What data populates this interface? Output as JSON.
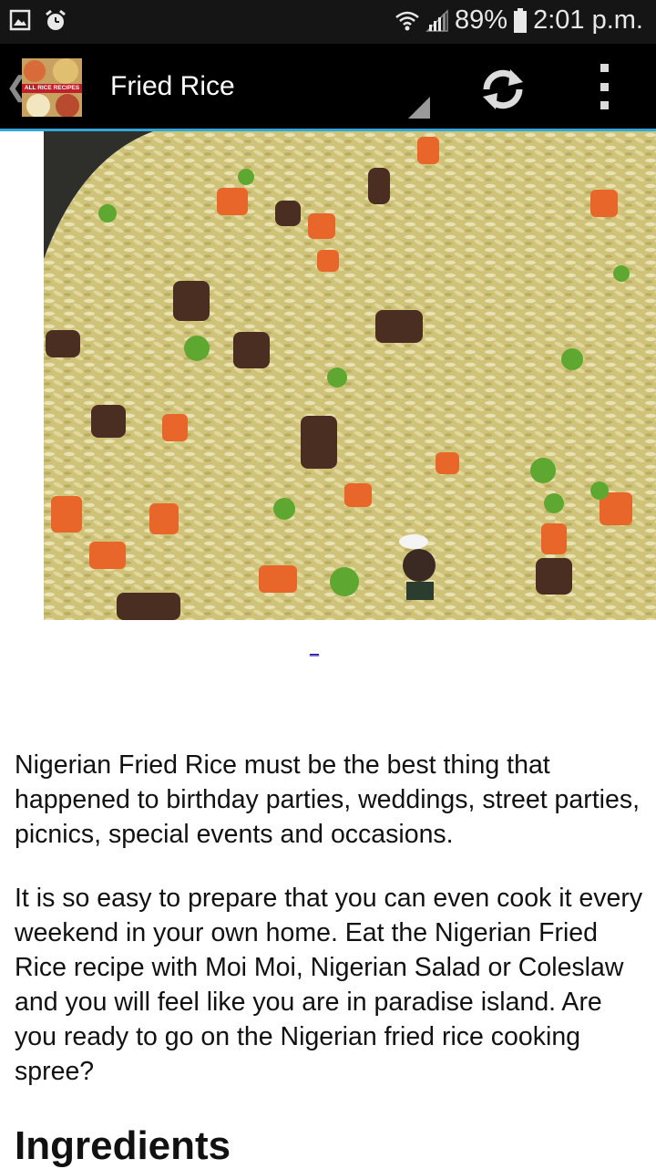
{
  "status_bar": {
    "battery": "89%",
    "time": "2:01 p.m.",
    "icons": [
      "image-icon",
      "alarm-icon",
      "wifi-icon",
      "signal-icon",
      "battery-icon"
    ]
  },
  "action_bar": {
    "title": "Fried Rice",
    "app_icon_text": "ALL RICE RECIPES",
    "icons": [
      "up-caret-icon",
      "refresh-icon",
      "overflow-menu-icon"
    ],
    "divider_color": "#33a6d9"
  },
  "content": {
    "link": "_",
    "paragraph_1": "Nigerian Fried Rice must be the best thing that happened to birthday parties, weddings, street parties, picnics, special events and occasions.",
    "paragraph_2": "It is so easy to prepare that you can even cook it every weekend in your own home. Eat the Nigerian Fried Rice recipe with Moi Moi, Nigerian Salad or Coleslaw and you will feel like you are in paradise island. Are you ready to go on the Nigerian fried rice cooking spree?",
    "heading": "Ingredients"
  }
}
